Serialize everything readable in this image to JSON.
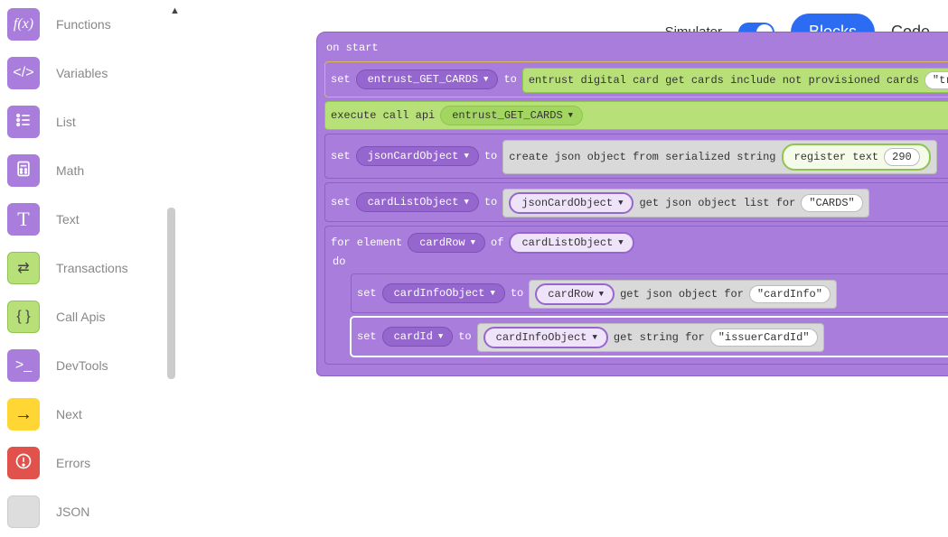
{
  "header": {
    "simulator_label": "Simulator",
    "blocks_label": "Blocks",
    "code_label": "Code"
  },
  "sidebar": {
    "items": [
      {
        "id": "functions",
        "label": "Functions",
        "icon": "fx",
        "style": "purple"
      },
      {
        "id": "variables",
        "label": "Variables",
        "icon": "code",
        "style": "purple"
      },
      {
        "id": "list",
        "label": "List",
        "icon": "list",
        "style": "purple"
      },
      {
        "id": "math",
        "label": "Math",
        "icon": "calc",
        "style": "purple"
      },
      {
        "id": "text",
        "label": "Text",
        "icon": "T",
        "style": "purple"
      },
      {
        "id": "transactions",
        "label": "Transactions",
        "icon": "swap",
        "style": "green"
      },
      {
        "id": "callapis",
        "label": "Call Apis",
        "icon": "braces",
        "style": "green"
      },
      {
        "id": "devtools",
        "label": "DevTools",
        "icon": "terminal",
        "style": "purple"
      },
      {
        "id": "next",
        "label": "Next",
        "icon": "arrow",
        "style": "yellow"
      },
      {
        "id": "errors",
        "label": "Errors",
        "icon": "exclaim",
        "style": "red"
      },
      {
        "id": "json",
        "label": "JSON",
        "icon": "blank",
        "style": "gray"
      }
    ]
  },
  "workspace": {
    "hat_label": "on start",
    "b1": {
      "set": "set",
      "var": "entrust_GET_CARDS",
      "to": "to",
      "call_text": "entrust digital card get cards include not provisioned cards",
      "val": "\"true\""
    },
    "b2": {
      "exec": "execute call api",
      "var": "entrust_GET_CARDS"
    },
    "b3": {
      "set": "set",
      "var": "jsonCardObject",
      "to": "to",
      "call_text": "create json object from serialized string",
      "reg": "register text",
      "reg_val": "290"
    },
    "b4": {
      "set": "set",
      "var": "cardListObject",
      "to": "to",
      "src": "jsonCardObject",
      "call_text": "get json object list for",
      "arg": "\"CARDS\""
    },
    "b5": {
      "for": "for element",
      "iter": "cardRow",
      "of": "of",
      "coll": "cardListObject",
      "do": "do"
    },
    "b6": {
      "set": "set",
      "var": "cardInfoObject",
      "to": "to",
      "src": "cardRow",
      "call_text": "get json object for",
      "arg": "\"cardInfo\""
    },
    "b7": {
      "set": "set",
      "var": "cardId",
      "to": "to",
      "src": "cardInfoObject",
      "call_text": "get string for",
      "arg": "\"issuerCardId\""
    }
  }
}
